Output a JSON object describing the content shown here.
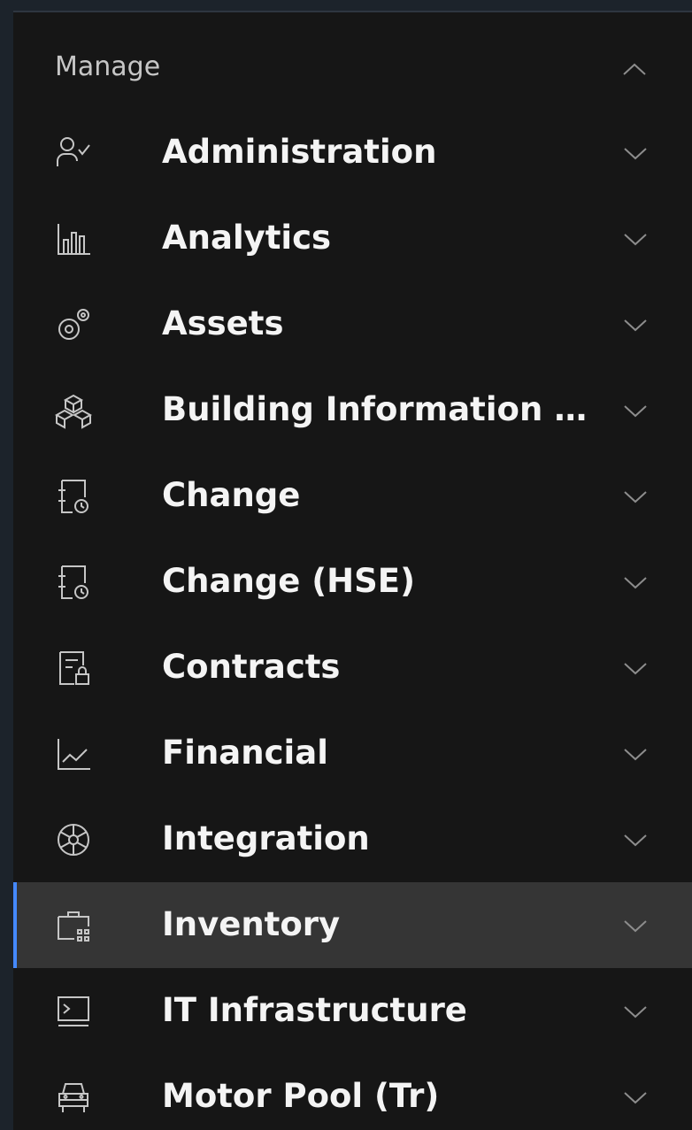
{
  "section": {
    "title": "Manage",
    "expanded": true
  },
  "nav": {
    "items": [
      {
        "label": "Administration",
        "icon": "user-admin-icon",
        "active": false
      },
      {
        "label": "Analytics",
        "icon": "bar-chart-icon",
        "active": false
      },
      {
        "label": "Assets",
        "icon": "gears-icon",
        "active": false
      },
      {
        "label": "Building Information M...",
        "icon": "building-blocks-icon",
        "active": false
      },
      {
        "label": "Change",
        "icon": "document-change-icon",
        "active": false
      },
      {
        "label": "Change (HSE)",
        "icon": "document-change-icon",
        "active": false
      },
      {
        "label": "Contracts",
        "icon": "document-lock-icon",
        "active": false
      },
      {
        "label": "Financial",
        "icon": "line-chart-icon",
        "active": false
      },
      {
        "label": "Integration",
        "icon": "network-icon",
        "active": false
      },
      {
        "label": "Inventory",
        "icon": "briefcase-grid-icon",
        "active": true
      },
      {
        "label": "IT Infrastructure",
        "icon": "terminal-icon",
        "active": false
      },
      {
        "label": "Motor Pool (Tr)",
        "icon": "vehicle-icon",
        "active": false
      }
    ]
  },
  "colors": {
    "background": "#161616",
    "active_background": "#353535",
    "active_indicator": "#4589ff",
    "label_text": "#f4f4f4",
    "section_text": "#c6c6c6",
    "icon": "#c6c6c6"
  }
}
